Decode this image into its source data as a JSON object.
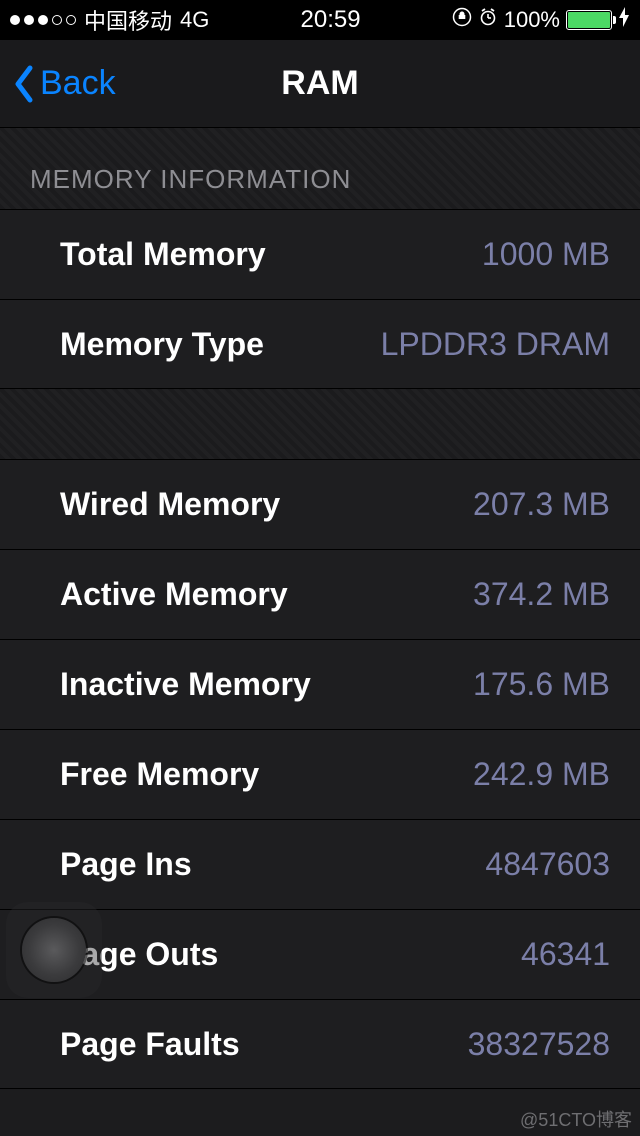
{
  "statusBar": {
    "carrier": "中国移动",
    "network": "4G",
    "time": "20:59",
    "battery": "100%"
  },
  "nav": {
    "back": "Back",
    "title": "RAM"
  },
  "sectionHeader": "MEMORY INFORMATION",
  "rowsA": [
    {
      "label": "Total Memory",
      "value": "1000 MB"
    },
    {
      "label": "Memory Type",
      "value": "LPDDR3 DRAM"
    }
  ],
  "rowsB": [
    {
      "label": "Wired Memory",
      "value": "207.3 MB"
    },
    {
      "label": "Active Memory",
      "value": "374.2 MB"
    },
    {
      "label": "Inactive Memory",
      "value": "175.6 MB"
    },
    {
      "label": "Free Memory",
      "value": "242.9 MB"
    },
    {
      "label": "Page Ins",
      "value": "4847603"
    },
    {
      "label": "Page Outs",
      "value": "46341"
    },
    {
      "label": "Page Faults",
      "value": "38327528"
    }
  ],
  "watermark": "@51CTO博客"
}
